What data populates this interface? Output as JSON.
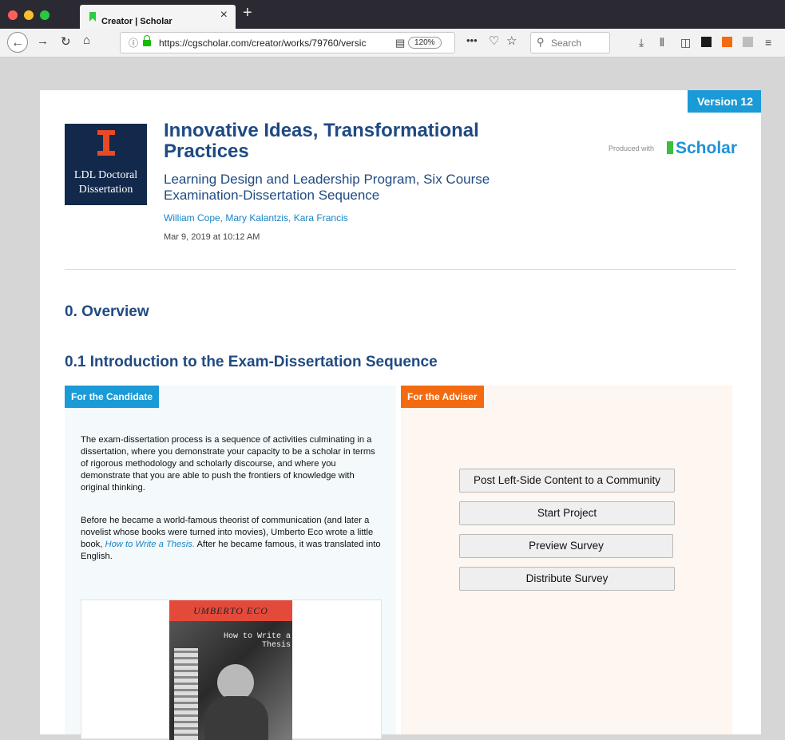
{
  "browser": {
    "tab_title": "Creator | Scholar",
    "new_tab": "+",
    "tab_close": "×",
    "url": "https://cgscholar.com/creator/works/79760/versic",
    "zoom": "120%",
    "search_placeholder": "Search",
    "icons": [
      "back-icon",
      "forward-icon",
      "reload-icon",
      "home-icon",
      "info-icon",
      "lock-icon",
      "reader-icon",
      "more-icon",
      "pocket-icon",
      "bookmark-star-icon",
      "search-icon",
      "download-icon",
      "library-icon",
      "sidebar-icon",
      "pdf-icon",
      "extension-icon",
      "extension-icon",
      "menu-icon"
    ]
  },
  "work": {
    "version": "Version 12",
    "logo_text_1": "LDL Doctoral",
    "logo_text_2": "Dissertation",
    "title": "Innovative Ideas, Transformational Practices",
    "subtitle": "Learning Design and Leadership Program, Six Course Examination-Dissertation Sequence",
    "authors": "William Cope, Mary Kalantzis, Kara Francis",
    "date": "Mar 9, 2019 at 10:12 AM",
    "produced_with": "Produced with",
    "brand": "Scholar"
  },
  "content": {
    "heading_overview": "0. Overview",
    "heading_intro": "0.1 Introduction to the Exam-Dissertation Sequence",
    "candidate_label": "For the Candidate",
    "adviser_label": "For the Adviser",
    "para1": "The exam-dissertation process is a sequence of activities culminating in a dissertation, where you demonstrate your capacity to be a scholar in terms of rigorous methodology and scholarly discourse, and where you demonstrate that you are able to push the frontiers of knowledge with original thinking.",
    "para2_before": "Before he became a world-famous theorist of communication (and later a novelist whose books were turned into movies), Umberto Eco wrote a little book, ",
    "para2_link": "How to Write a Thesis.",
    "para2_after": " After he became famous, it was translated into English.",
    "book_author": "UMBERTO ECO",
    "book_title": "How to Write a Thesis"
  },
  "buttons": {
    "post": "Post Left-Side Content to a Community",
    "start": "Start Project",
    "preview": "Preview Survey",
    "distribute": "Distribute Survey"
  },
  "colors": {
    "accent_blue": "#1a9ad6",
    "adviser_orange": "#f36a10",
    "heading_navy": "#1f4a82"
  }
}
